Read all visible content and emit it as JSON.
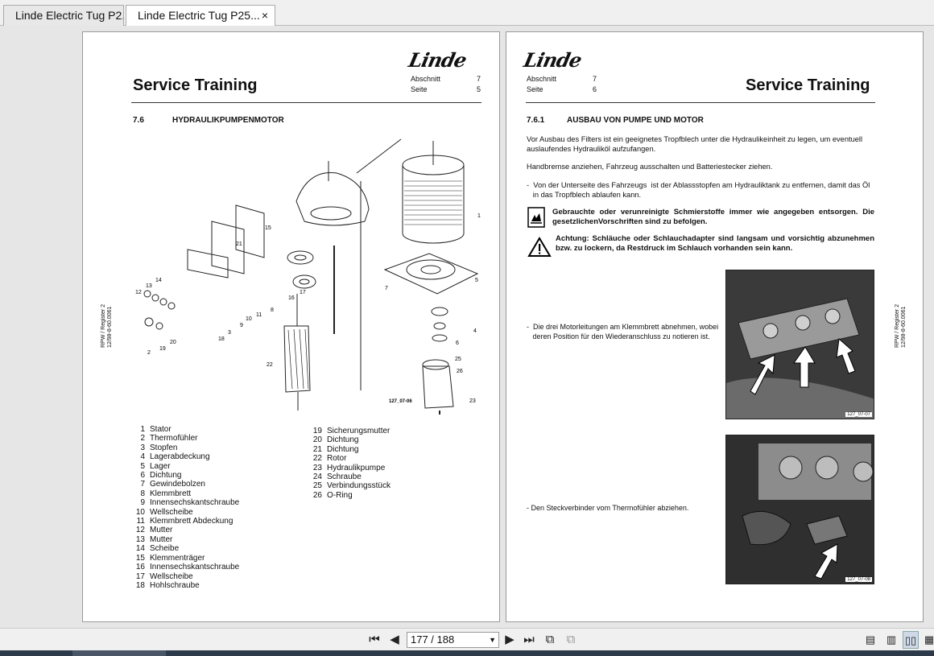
{
  "tabs": [
    {
      "label": "Linde Electric Tug P2..."
    },
    {
      "label": "Linde Electric Tug P25...",
      "close": "×"
    }
  ],
  "left_page": {
    "logo": "Linde",
    "title": "Service Training",
    "abschnitt_label": "Abschnitt",
    "abschnitt_value": "7",
    "seite_label": "Seite",
    "seite_value": "5",
    "section_number": "7.6",
    "section_title": "HYDRAULIKPUMPENMOTOR",
    "side_text": "RPW / Register 2\n12/98-8-60.0061",
    "figure_code": "127_07-06",
    "parts_col1": [
      {
        "n": "1",
        "t": "Stator"
      },
      {
        "n": "2",
        "t": "Thermofühler"
      },
      {
        "n": "3",
        "t": "Stopfen"
      },
      {
        "n": "4",
        "t": "Lagerabdeckung"
      },
      {
        "n": "5",
        "t": "Lager"
      },
      {
        "n": "6",
        "t": "Dichtung"
      },
      {
        "n": "7",
        "t": "Gewindebolzen"
      },
      {
        "n": "8",
        "t": "Klemmbrett"
      },
      {
        "n": "9",
        "t": "Innensechskantschraube"
      },
      {
        "n": "10",
        "t": "Wellscheibe"
      },
      {
        "n": "11",
        "t": "Klemmbrett Abdeckung"
      },
      {
        "n": "12",
        "t": "Mutter"
      },
      {
        "n": "13",
        "t": "Mutter"
      },
      {
        "n": "14",
        "t": "Scheibe"
      },
      {
        "n": "15",
        "t": "Klemmenträger"
      },
      {
        "n": "16",
        "t": "Innensechskantschraube"
      },
      {
        "n": "17",
        "t": "Wellscheibe"
      },
      {
        "n": "18",
        "t": "Hohlschraube"
      }
    ],
    "parts_col2": [
      {
        "n": "19",
        "t": "Sicherungsmutter"
      },
      {
        "n": "20",
        "t": "Dichtung"
      },
      {
        "n": "21",
        "t": "Dichtung"
      },
      {
        "n": "22",
        "t": "Rotor"
      },
      {
        "n": "23",
        "t": "Hydraulikpumpe"
      },
      {
        "n": "24",
        "t": "Schraube"
      },
      {
        "n": "25",
        "t": "Verbindungsstück"
      },
      {
        "n": "26",
        "t": "O-Ring"
      }
    ],
    "callouts": [
      "1",
      "2",
      "3",
      "4",
      "5",
      "6",
      "7",
      "8",
      "9",
      "10",
      "11",
      "12",
      "13",
      "14",
      "15",
      "16",
      "17",
      "18",
      "19",
      "20",
      "21",
      "22",
      "23",
      "24",
      "25",
      "26"
    ]
  },
  "right_page": {
    "logo": "Linde",
    "title": "Service Training",
    "abschnitt_label": "Abschnitt",
    "abschnitt_value": "7",
    "seite_label": "Seite",
    "seite_value": "6",
    "section_number": "7.6.1",
    "section_title": "AUSBAU VON PUMPE UND MOTOR",
    "p1": "Vor Ausbau des Filters ist ein geeignetes Tropfblech unter die Hydraulikeinheit zu legen, um eventuell auslaufendes Hydrauliköl aufzufangen.",
    "p2": "Handbremse anziehen, Fahrzeug ausschalten und Batteriestecker ziehen.",
    "p3": "-  Von der Unterseite des Fahrzeugs  ist der Ablassstopfen am Hydrauliktank zu entfernen, damit das Öl\n   in das Tropfblech ablaufen kann.",
    "env_note": "Gebrauchte oder verunreinigte Schmierstoffe immer wie angegeben entsorgen.  Die gesetzlichenVorschriften sind zu befolgen.",
    "warn_note": "Achtung: Schläuche oder Schlauchadapter sind langsam und vorsichtig abzunehmen bzw.  zu lockern, da Restdruck im Schlauch vorhanden sein kann.",
    "step1": "-  Die drei Motorleitungen am Klemmbrett abnehmen, wobei\n   deren Position für den Wiederanschluss zu notieren ist.",
    "step2": "-  Den Steckverbinder vom Thermofühler abziehen.",
    "photo1_code": "127_07-07",
    "photo2_code": "127_07-08",
    "side_text": "RPW / Register 2\n12/98-8-60.0061"
  },
  "toolbar": {
    "page_value": "177 / 188",
    "icons": [
      "first-page-icon",
      "prev-page-icon",
      "next-page-icon",
      "last-page-icon",
      "rotate-icon",
      "copy-icon",
      "single-page-icon",
      "continuous-icon",
      "two-page-icon",
      "two-page-continuous-icon"
    ]
  }
}
